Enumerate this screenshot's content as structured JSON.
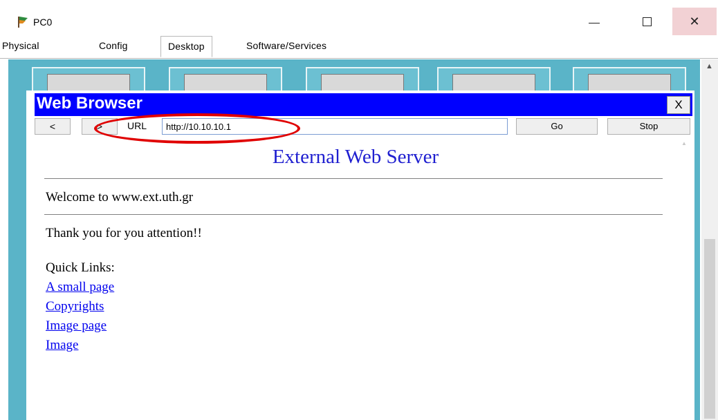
{
  "window": {
    "title": "PC0",
    "close_glyph": "✕"
  },
  "tabs": [
    {
      "label": "Physical"
    },
    {
      "label": "Config"
    },
    {
      "label": "Desktop",
      "active": true
    },
    {
      "label": "Software/Services"
    }
  ],
  "browser": {
    "title": "Web Browser",
    "close_label": "X",
    "back_label": "<",
    "forward_label": ">",
    "url_label": "URL",
    "url_value": "http://10.10.10.1",
    "go_label": "Go",
    "stop_label": "Stop"
  },
  "page": {
    "heading": "External Web Server",
    "welcome": "Welcome to www.ext.uth.gr",
    "thanks": "Thank you for you attention!!",
    "quick_links_label": "Quick Links:",
    "links": [
      "A small page",
      "Copyrights",
      "Image page",
      "Image"
    ]
  },
  "colors": {
    "browser_titlebar": "#0000ff",
    "desktop_background": "#5ab4c8",
    "link": "#0000ee",
    "highlight_ellipse": "#e00000"
  }
}
